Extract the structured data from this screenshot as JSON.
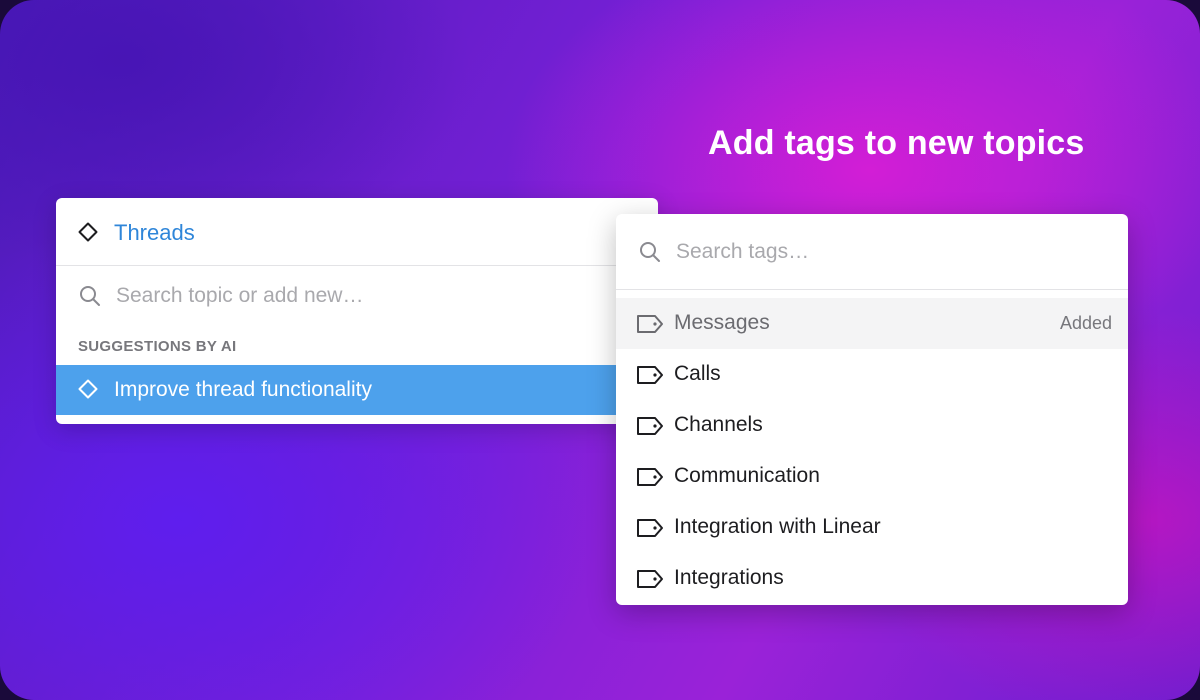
{
  "headline": "Add tags to new topics",
  "topic_panel": {
    "title": "Threads",
    "search_placeholder": "Search topic or add new…",
    "section_label": "SUGGESTIONS BY AI",
    "suggestion": "Improve thread functionality"
  },
  "tag_panel": {
    "search_placeholder": "Search tags…",
    "tags": [
      {
        "label": "Messages",
        "status": "Added"
      },
      {
        "label": "Calls",
        "status": ""
      },
      {
        "label": "Channels",
        "status": ""
      },
      {
        "label": "Communication",
        "status": ""
      },
      {
        "label": "Integration with Linear",
        "status": ""
      },
      {
        "label": "Integrations",
        "status": ""
      }
    ]
  },
  "colors": {
    "accent_blue": "#2f86d9",
    "selected_row": "#4da1ec",
    "added_row": "#f4f4f5"
  },
  "icons": {
    "topic": "diamond-icon",
    "add_tag": "add-tag-icon",
    "search": "search-icon",
    "tag": "tag-icon"
  }
}
